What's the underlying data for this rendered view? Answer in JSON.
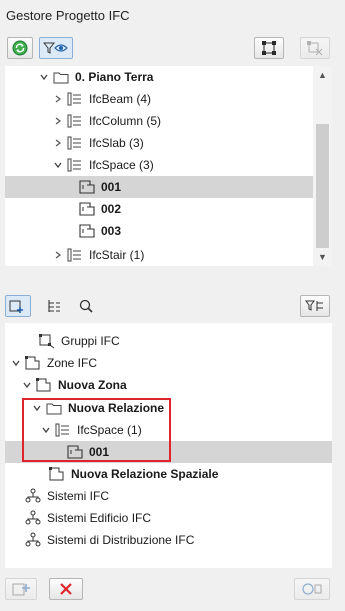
{
  "title": "Gestore Progetto IFC",
  "top_toolbar": {
    "refresh_icon": "refresh-icon",
    "filter_view_icon": "filter-eye-icon",
    "select_icon": "select-element-icon",
    "deselect_icon": "deselect-element-icon"
  },
  "tree1": {
    "items": [
      {
        "label": "0. Piano Terra",
        "bold": true
      },
      {
        "label": "IfcBeam (4)"
      },
      {
        "label": "IfcColumn (5)"
      },
      {
        "label": "IfcSlab (3)"
      },
      {
        "label": "IfcSpace (3)"
      },
      {
        "label": "001",
        "bold": true
      },
      {
        "label": "002",
        "bold": true
      },
      {
        "label": "003",
        "bold": true
      },
      {
        "label": "IfcStair (1)"
      }
    ]
  },
  "tree2": {
    "items": [
      {
        "label": "Gruppi IFC"
      },
      {
        "label": "Zone IFC"
      },
      {
        "label": "Nuova Zona",
        "bold": true
      },
      {
        "label": "Nuova Relazione",
        "bold": true
      },
      {
        "label": "IfcSpace (1)"
      },
      {
        "label": "001",
        "bold": true
      },
      {
        "label": "Nuova Relazione Spaziale",
        "bold": true
      },
      {
        "label": "Sistemi IFC"
      },
      {
        "label": "Sistemi Edificio IFC"
      },
      {
        "label": "Sistemi di Distribuzione IFC"
      }
    ]
  },
  "colors": {
    "highlight_box": "#e0242a",
    "selection_bg": "#d5d5d5",
    "delete_red": "#e0242a",
    "refresh_green": "#2a9d3c"
  }
}
